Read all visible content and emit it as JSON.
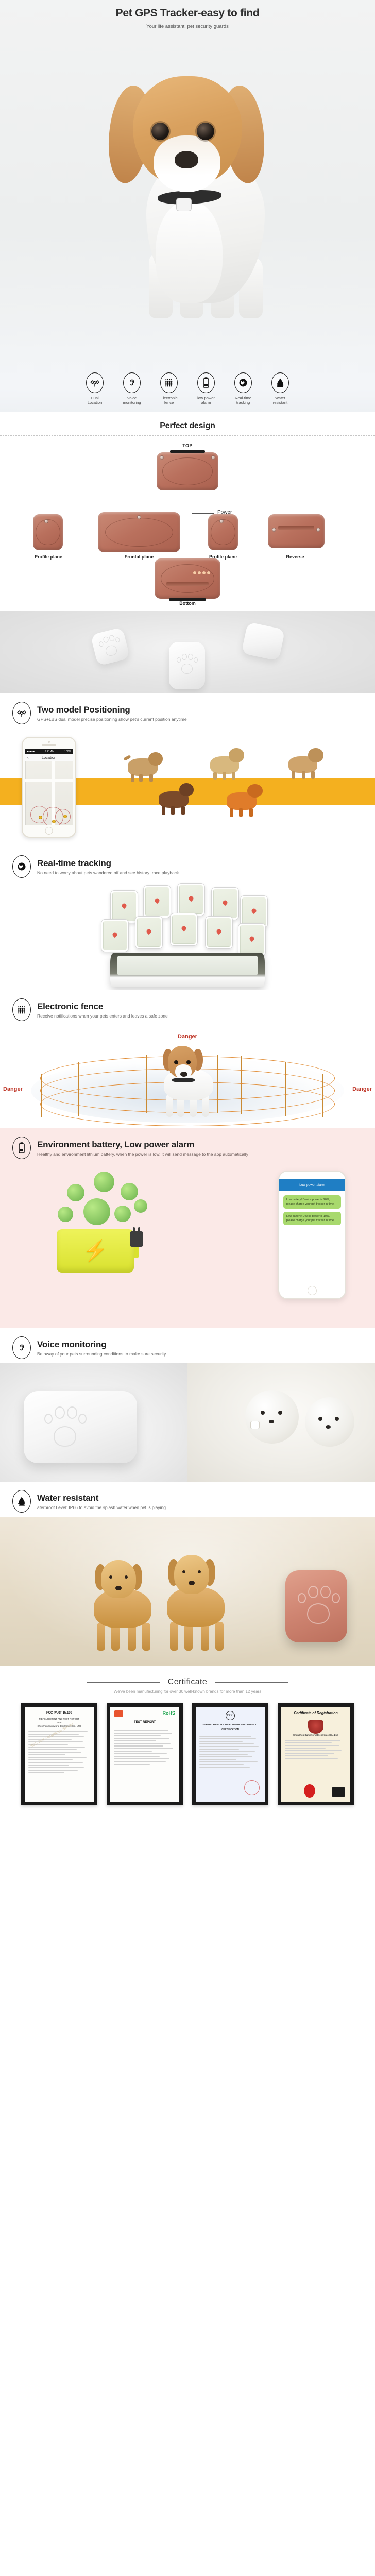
{
  "hero": {
    "title": "Pet GPS Tracker-easy to find",
    "subtitle": "Your life assistant, pet security guards"
  },
  "feature_icons": [
    {
      "icon": "satellite-icon",
      "label": "Dual\nLocation"
    },
    {
      "icon": "ear-icon",
      "label": "Voice\nmonitoring"
    },
    {
      "icon": "fence-icon",
      "label": "Electronic\nfence"
    },
    {
      "icon": "battery-icon",
      "label": "low power\nalarm"
    },
    {
      "icon": "globe-icon",
      "label": "Real-time\ntracking"
    },
    {
      "icon": "waterdrop-icon",
      "label": "Water\nresistant"
    }
  ],
  "design": {
    "title": "Perfect design",
    "top_label": "TOP",
    "power_label": "Power",
    "bottom_label": "Bottom",
    "captions": [
      "Profile plane",
      "Frontal plane",
      "Profile plane",
      "Reverse"
    ]
  },
  "sections": [
    {
      "icon": "satellite-icon",
      "title": "Two model Positioning",
      "subtitle": "GPS+LBS dual model precise positioning show pet's current position anytime"
    },
    {
      "icon": "globe-icon",
      "title": "Real-time tracking",
      "subtitle": "No need to worry about pets wandered off and see history trace playback"
    },
    {
      "icon": "fence-icon",
      "title": "Electronic fence",
      "subtitle": "Receive notifications when your pets enters and leaves a safe zone"
    },
    {
      "icon": "battery-icon",
      "title": "Environment battery, Low power alarm",
      "subtitle": "Healthy and environment lithium battery, when the power is low, it will send message to the app automatically"
    },
    {
      "icon": "ear-icon",
      "title": "Voice monitoring",
      "subtitle": "Be away of your pets surrounding conditions to make sure security"
    },
    {
      "icon": "waterdrop-icon",
      "title": "Water resistant",
      "subtitle": "aterproof Level: IP66 to avoid the splash water when pet is playing"
    }
  ],
  "phone_app": {
    "status_left": "●●●●●",
    "status_time": "9:41 AM",
    "status_right": "100%",
    "nav_back": "‹",
    "nav_title": "Location"
  },
  "fence": {
    "danger_top": "Danger",
    "danger_left": "Danger",
    "danger_right": "Danger"
  },
  "battery_app": {
    "app_bar": "Low power alarm",
    "messages": [
      "Low battery! Device power is 20%, please charge your pet tracker in time.",
      "Low battery! Device power is 10%, please charge your pet tracker in time."
    ]
  },
  "certificate": {
    "title": "Certificate",
    "subtitle": "We've been manufacturing for over 30 well-known brands for more than 12 years",
    "items": [
      {
        "name": "fcc-certificate",
        "title": "FCC PART 15.109",
        "subtitle": "MEASUREMENT AND TEST REPORT\nFOR\nShenzhen Sungworld Electronics Co., LTD",
        "badge": ""
      },
      {
        "name": "rohs-certificate",
        "title": "TEST REPORT",
        "subtitle": "",
        "badge": "RoHS"
      },
      {
        "name": "ccc-certificate",
        "title": "CERTIFICATE FOR CHINA COMPULSORY PRODUCT CERTIFICATION",
        "subtitle": "",
        "badge": "CCC"
      },
      {
        "name": "registration-certificate",
        "title": "Certificate of Registration",
        "subtitle": "Shenzhen Sungworld Electronic Co., Ltd.",
        "badge": "QA"
      }
    ]
  },
  "colors": {
    "accent_orange": "#f4b01f",
    "danger_red": "#c0392b",
    "pink_bg": "#fbe9e7",
    "device_rose": "#bb6f5c",
    "fence_orange": "#e08b33",
    "app_blue": "#1f7ec4",
    "bubble_green": "#a8d96d"
  }
}
